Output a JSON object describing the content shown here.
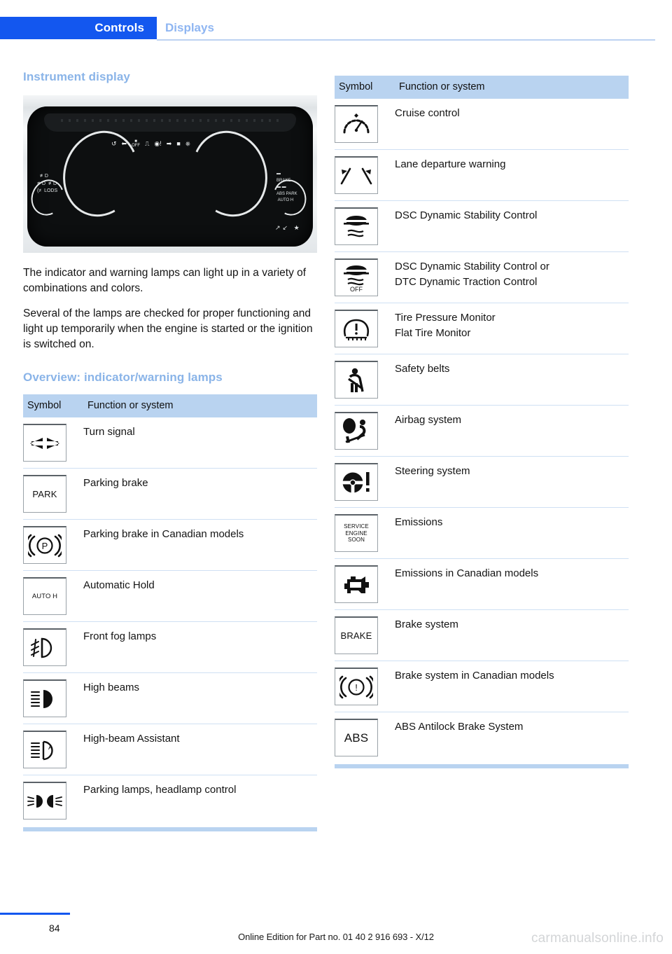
{
  "nav": {
    "active_tab": "Controls",
    "inactive_tab": "Displays",
    "active_bg": "#1357ef",
    "inactive_color": "#8fb6f2"
  },
  "left": {
    "heading": "Instrument display",
    "figure": {
      "alt": "instrument-cluster-photo",
      "top_tellers": [
        "recirc",
        "left-arrow",
        "dsc-off",
        "car",
        "steering",
        "right-arrow",
        "seatbelt",
        "power"
      ],
      "left_tellers": [
        "fog-rear",
        "fog-front",
        "high-beam",
        "low-beam",
        "LODS"
      ],
      "right_tellers": [
        "BRAKE",
        "ABS",
        "PARK",
        "AUTO H"
      ],
      "bottom_tellers": [
        "lane",
        "airbag"
      ]
    },
    "paragraphs": [
      "The indicator and warning lamps can light up in a variety of combinations and colors.",
      "Several of the lamps are checked for proper functioning and light up temporarily when the engine is started or the ignition is switched on."
    ],
    "heading2": "Overview: indicator/warning lamps",
    "table": {
      "columns": [
        "Symbol",
        "Function or system"
      ],
      "rows": [
        {
          "symbol": "turn-signal-icon",
          "symbol_text": "",
          "label": "Turn signal"
        },
        {
          "symbol": "park-text-icon",
          "symbol_text": "PARK",
          "label": "Parking brake"
        },
        {
          "symbol": "parking-brake-p-icon",
          "symbol_text": "",
          "label": "Parking brake in Canadian models"
        },
        {
          "symbol": "auto-hold-icon",
          "symbol_text": "AUTO H",
          "label": "Automatic Hold"
        },
        {
          "symbol": "front-fog-lamp-icon",
          "symbol_text": "",
          "label": "Front fog lamps"
        },
        {
          "symbol": "high-beam-icon",
          "symbol_text": "",
          "label": "High beams"
        },
        {
          "symbol": "high-beam-assistant-icon",
          "symbol_text": "",
          "label": "High-beam Assistant"
        },
        {
          "symbol": "parking-lamps-icon",
          "symbol_text": "",
          "label": "Parking lamps, headlamp control"
        }
      ]
    }
  },
  "right": {
    "table": {
      "columns": [
        "Symbol",
        "Function or system"
      ],
      "rows": [
        {
          "symbol": "cruise-control-icon",
          "symbol_text": "",
          "label": "Cruise control"
        },
        {
          "symbol": "lane-departure-icon",
          "symbol_text": "",
          "label": "Lane departure warning"
        },
        {
          "symbol": "dsc-icon",
          "symbol_text": "",
          "label": "DSC Dynamic Stability Control"
        },
        {
          "symbol": "dsc-off-icon",
          "symbol_text": "OFF",
          "label": "DSC Dynamic Stability Control or\nDTC Dynamic Traction Control"
        },
        {
          "symbol": "tire-pressure-icon",
          "symbol_text": "",
          "label": "Tire Pressure Monitor\nFlat Tire Monitor"
        },
        {
          "symbol": "safety-belt-icon",
          "symbol_text": "",
          "label": "Safety belts"
        },
        {
          "symbol": "airbag-icon",
          "symbol_text": "",
          "label": "Airbag system"
        },
        {
          "symbol": "steering-system-icon",
          "symbol_text": "",
          "label": "Steering system"
        },
        {
          "symbol": "service-engine-soon-icon",
          "symbol_text": "SERVICE ENGINE SOON",
          "label": "Emissions"
        },
        {
          "symbol": "check-engine-icon",
          "symbol_text": "",
          "label": "Emissions in Canadian models"
        },
        {
          "symbol": "brake-text-icon",
          "symbol_text": "BRAKE",
          "label": "Brake system"
        },
        {
          "symbol": "brake-warning-icon",
          "symbol_text": "",
          "label": "Brake system in Canadian models"
        },
        {
          "symbol": "abs-text-icon",
          "symbol_text": "ABS",
          "label": "ABS Antilock Brake System"
        }
      ]
    }
  },
  "footer": {
    "page_number": "84",
    "edition_text": "Online Edition for Part no. 01 40 2 916 693 - X/12",
    "watermark": "carmanualsonline.info"
  }
}
